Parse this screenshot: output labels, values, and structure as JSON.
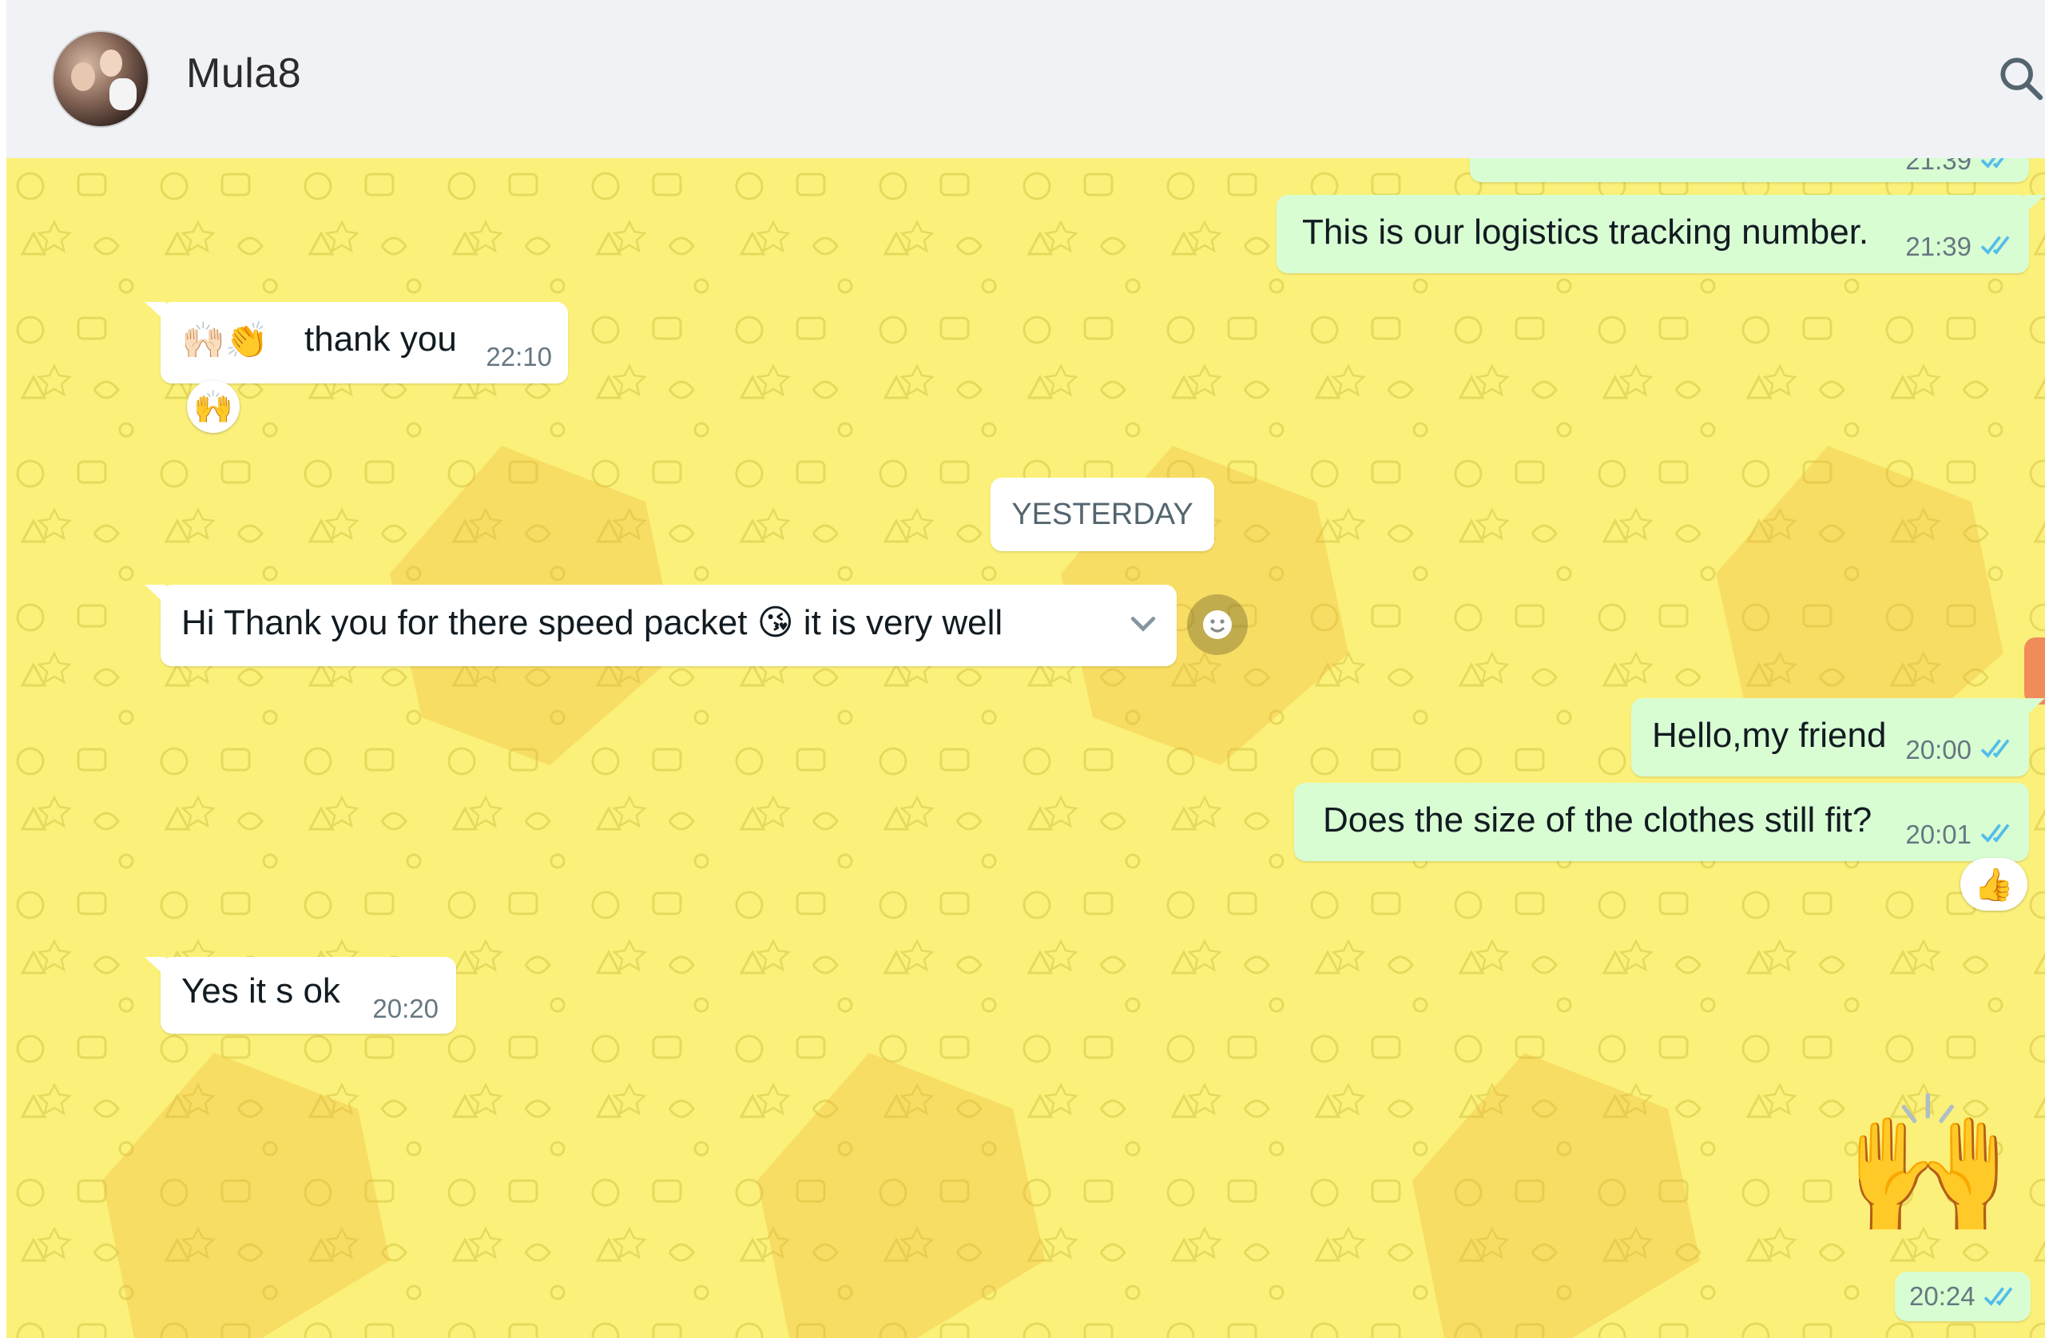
{
  "header": {
    "contact_name": "Mula8",
    "avatar_icon": "contact-avatar",
    "search_icon": "search-icon"
  },
  "messages": {
    "m1": {
      "direction": "out",
      "text": "",
      "time": "21:39",
      "status": "read"
    },
    "m2": {
      "direction": "out",
      "text": "This is our logistics tracking number.",
      "time": "21:39",
      "status": "read"
    },
    "m3": {
      "direction": "in",
      "text": "thank you",
      "emojis": "🙌🏻👏",
      "time": "22:10",
      "reaction": "🙌"
    },
    "m4": {
      "direction": "in",
      "text": "Hi Thank you for there speed packet 😘 it is very well",
      "time": ""
    },
    "m5": {
      "direction": "out",
      "text": "Hello,my friend",
      "time": "20:00",
      "status": "read"
    },
    "m6": {
      "direction": "out",
      "text": "Does the size of the clothes still fit?",
      "time": "20:01",
      "status": "read",
      "reaction": "👍"
    },
    "m7": {
      "direction": "in",
      "text": "Yes it s ok",
      "time": "20:20"
    },
    "m8": {
      "direction": "out",
      "text": "🙌",
      "time": "20:24",
      "status": "read"
    }
  },
  "date_divider": "YESTERDAY",
  "colors": {
    "chat_background": "#fbf17a",
    "incoming_bubble": "#ffffff",
    "outgoing_bubble": "#d9fdd3",
    "read_ticks": "#53bdeb",
    "header_background": "#f0f2f5"
  }
}
